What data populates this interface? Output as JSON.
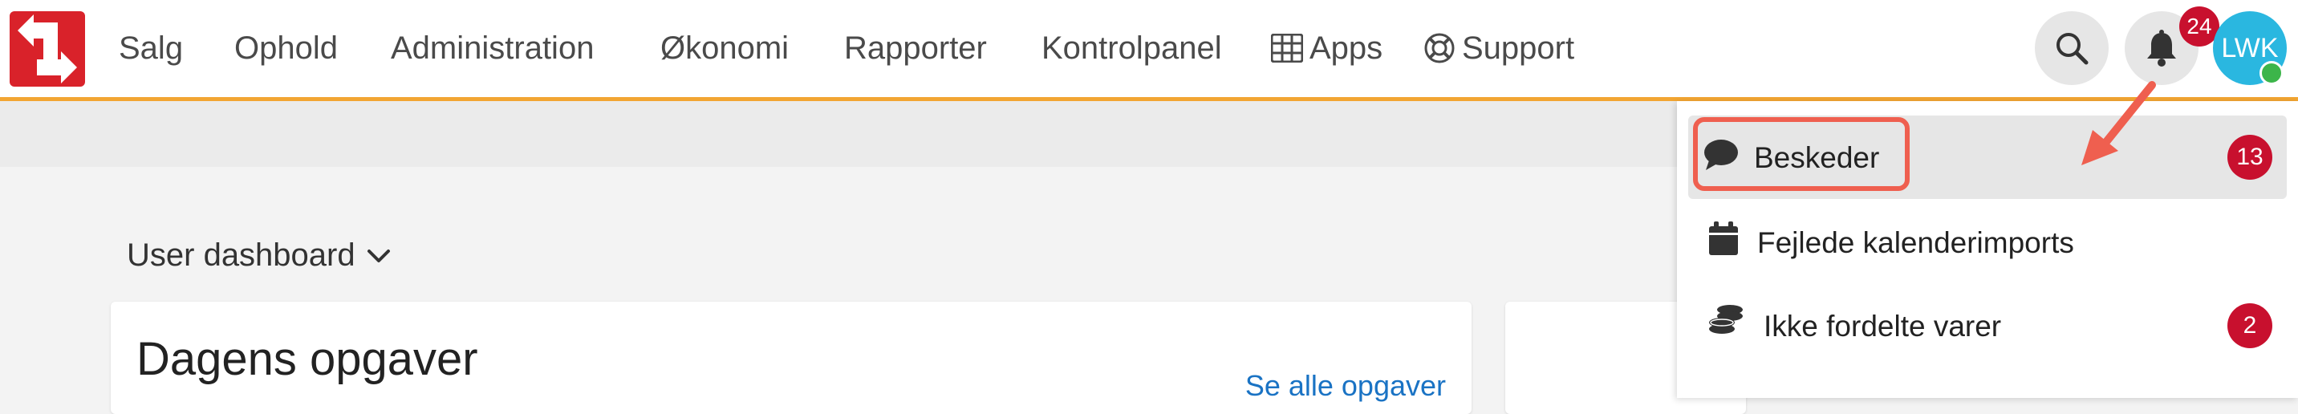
{
  "nav": {
    "items": [
      "Salg",
      "Ophold",
      "Administration",
      "Økonomi",
      "Rapporter",
      "Kontrolpanel"
    ],
    "apps_label": "Apps",
    "support_label": "Support"
  },
  "header": {
    "notification_count": "24",
    "avatar_initials": "LWK"
  },
  "dashboard": {
    "selector_label": "User dashboard"
  },
  "card": {
    "title": "Dagens opgaver",
    "link": "Se alle opgaver"
  },
  "dropdown": {
    "items": [
      {
        "label": "Beskeder",
        "badge": "13"
      },
      {
        "label": "Fejlede kalenderimports",
        "badge": ""
      },
      {
        "label": "Ikke fordelte varer",
        "badge": "2"
      }
    ]
  },
  "colors": {
    "brand_red": "#d9222a",
    "accent_orange": "#f2a532",
    "badge_red": "#c8102e",
    "avatar_blue": "#2ab7e0",
    "link_blue": "#1a73c4",
    "annotation_red": "#ef5f4f"
  },
  "icons": {
    "logo": "logo-icon",
    "apps": "grid-icon",
    "support": "lifebuoy-icon",
    "search": "search-icon",
    "notifications": "bell-icon",
    "messages": "chat-bubble-icon",
    "calendar": "calendar-icon",
    "stock": "coins-icon"
  }
}
